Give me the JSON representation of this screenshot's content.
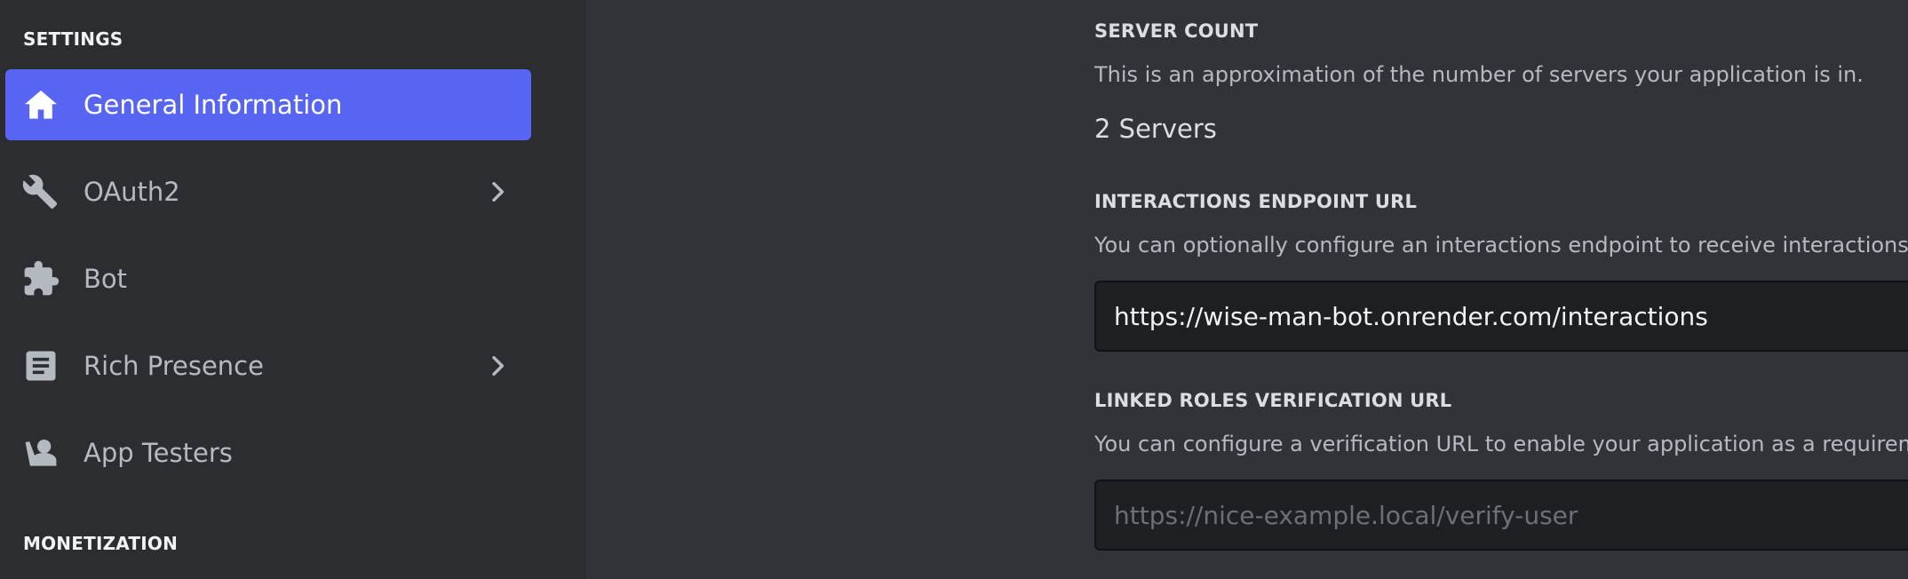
{
  "sidebar": {
    "settings_header": "SETTINGS",
    "monetization_header": "MONETIZATION",
    "items": [
      {
        "label": "General Information",
        "icon": "home-icon",
        "active": true
      },
      {
        "label": "OAuth2",
        "icon": "wrench-icon",
        "has_submenu": true
      },
      {
        "label": "Bot",
        "icon": "puzzle-icon"
      },
      {
        "label": "Rich Presence",
        "icon": "document-icon",
        "has_submenu": true
      },
      {
        "label": "App Testers",
        "icon": "person-icon"
      }
    ]
  },
  "main": {
    "server_count": {
      "label": "SERVER COUNT",
      "description": "This is an approximation of the number of servers your application is in.",
      "value": "2 Servers"
    },
    "interactions_endpoint": {
      "label": "INTERACTIONS ENDPOINT URL",
      "description": "You can optionally configure an interactions endpoint to receive interactions via HTTP POSTs rather than over Gateway with a bot user.",
      "value": "https://wise-man-bot.onrender.com/interactions"
    },
    "linked_roles": {
      "label": "LINKED ROLES VERIFICATION URL",
      "description": "You can configure a verification URL to enable your application as a requirement in a server role's Links settings",
      "placeholder": "https://nice-example.local/verify-user",
      "value": ""
    }
  },
  "colors": {
    "accent": "#5865f2",
    "sidebar_bg": "#2b2d31",
    "main_bg": "#313338",
    "input_bg": "#1e1f22"
  }
}
